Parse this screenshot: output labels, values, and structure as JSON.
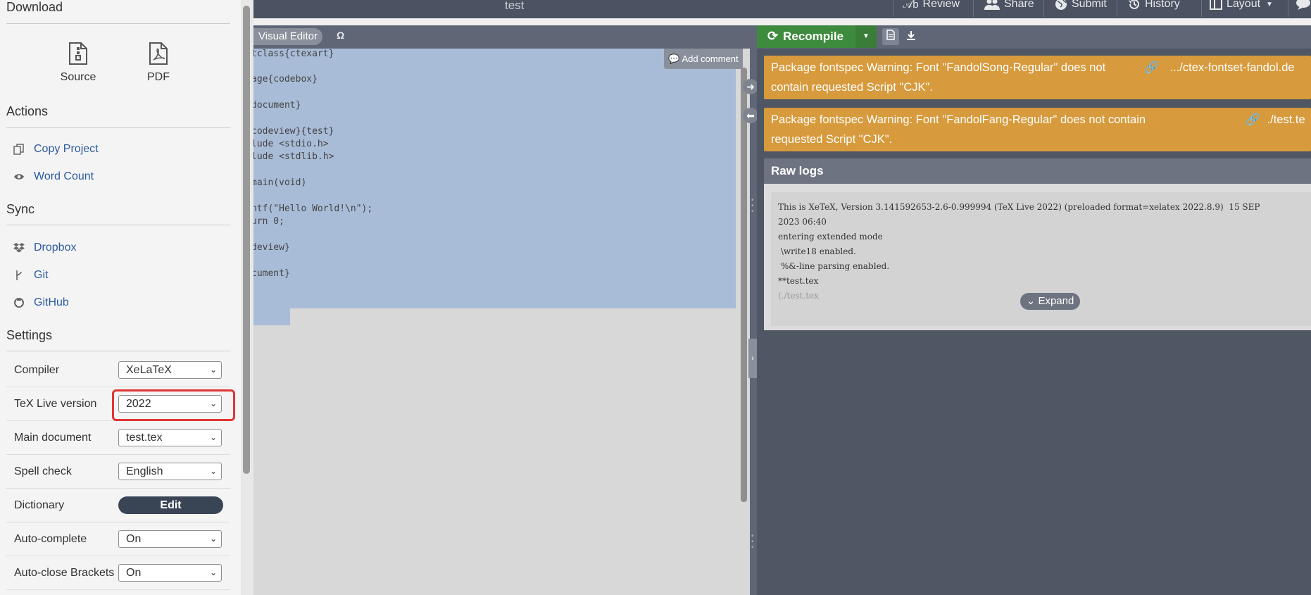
{
  "window": {
    "title": "test"
  },
  "topbar": {
    "review": "Review",
    "share": "Share",
    "submit": "Submit",
    "history": "History",
    "layout": "Layout"
  },
  "sidebar": {
    "download": {
      "title": "Download",
      "source": "Source",
      "pdf": "PDF"
    },
    "actions": {
      "title": "Actions",
      "copy_project": "Copy Project",
      "word_count": "Word Count"
    },
    "sync": {
      "title": "Sync",
      "dropbox": "Dropbox",
      "git": "Git",
      "github": "GitHub"
    },
    "settings": {
      "title": "Settings",
      "compiler": {
        "label": "Compiler",
        "value": "XeLaTeX"
      },
      "texlive": {
        "label": "TeX Live version",
        "value": "2022"
      },
      "main_doc": {
        "label": "Main document",
        "value": "test.tex"
      },
      "spell": {
        "label": "Spell check",
        "value": "English"
      },
      "dictionary": {
        "label": "Dictionary",
        "button": "Edit"
      },
      "autocomplete": {
        "label": "Auto-complete",
        "value": "On"
      },
      "autoclose": {
        "label": "Auto-close Brackets",
        "value": "On"
      }
    }
  },
  "editor": {
    "visual_editor": "Visual Editor",
    "omega": "Ω",
    "add_comment": "Add comment",
    "lines": [
      "tclass{ctexart}",
      "",
      "age{codebox}",
      "",
      "document}",
      "",
      "codeview}{test}",
      "lude <stdio.h>",
      "lude <stdlib.h>",
      "",
      "main(void)",
      "",
      "ntf(\"Hello World!\\n\");",
      "urn 0;",
      "",
      "deview}",
      "",
      "cument}"
    ]
  },
  "pdf": {
    "recompile": "Recompile"
  },
  "logs": {
    "warnings": [
      {
        "message": "Package fontspec Warning: Font \"FandolSong-Regular\" does not contain requested Script \"CJK\".",
        "file": ".../ctex-fontset-fandol.de"
      },
      {
        "message": "Package fontspec Warning: Font \"FandolFang-Regular\" does not contain requested Script \"CJK\".",
        "file": "./test.te"
      }
    ],
    "raw_title": "Raw logs",
    "raw_lines": [
      "This is XeTeX, Version 3.141592653-2.6-0.999994 (TeX Live 2022) (preloaded format=xelatex 2022.8.9)  15 SEP",
      "2023 06:40",
      "entering extended mode",
      " \\write18 enabled.",
      " %&-line parsing enabled.",
      "**test.tex",
      "(./test.tex"
    ],
    "expand": "Expand"
  },
  "colors": {
    "warning": "#d79a3c",
    "recompile": "#3f8b3e",
    "link": "#2b5a9f",
    "highlight": "#e03535"
  }
}
